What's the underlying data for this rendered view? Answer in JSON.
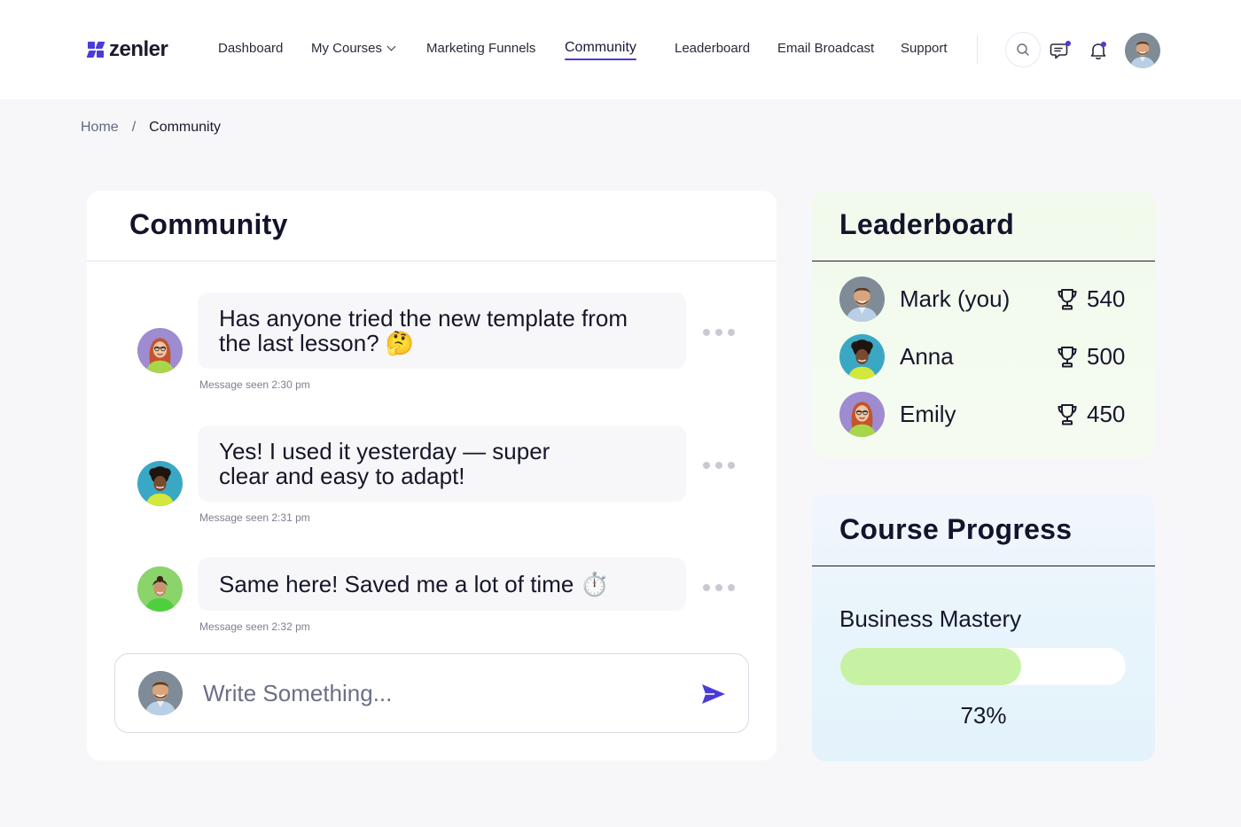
{
  "brand": {
    "name": "zenler",
    "accent_color": "#4b3bd6"
  },
  "nav": {
    "items": [
      {
        "label": "Dashboard"
      },
      {
        "label": "My Courses",
        "has_dropdown": true
      },
      {
        "label": "Marketing Funnels"
      },
      {
        "label": "Community",
        "active": true
      },
      {
        "label": "Leaderboard"
      },
      {
        "label": "Email Broadcast"
      },
      {
        "label": "Support"
      }
    ]
  },
  "header_icons": [
    "search-icon",
    "chat-icon",
    "bell-icon",
    "avatar"
  ],
  "breadcrumb": {
    "home": "Home",
    "separator": "/",
    "current": "Community"
  },
  "community": {
    "title": "Community",
    "messages": [
      {
        "lines": [
          "Has anyone tried the new template from",
          "the last lesson? 🤔"
        ],
        "seen": "Message seen 2:30 pm",
        "avatar": "red-haired woman, purple background"
      },
      {
        "lines": [
          "Yes! I used it yesterday — super",
          "clear and easy to adapt!"
        ],
        "seen": "Message seen 2:31 pm",
        "avatar": "curly-haired woman, teal background"
      },
      {
        "lines": [
          "Same here! Saved me a lot of time ⏱️"
        ],
        "seen": "Message seen 2:32 pm",
        "avatar": "woman in green, green background"
      }
    ],
    "composer": {
      "placeholder": "Write Something..."
    }
  },
  "leaderboard": {
    "title": "Leaderboard",
    "entries": [
      {
        "name": "Mark (you)",
        "score": "540"
      },
      {
        "name": "Anna",
        "score": "500"
      },
      {
        "name": "Emily",
        "score": "450"
      }
    ]
  },
  "course_progress": {
    "title": "Course Progress",
    "course": "Business Mastery",
    "progress_fraction": 0.635,
    "percent_label": "73%"
  }
}
